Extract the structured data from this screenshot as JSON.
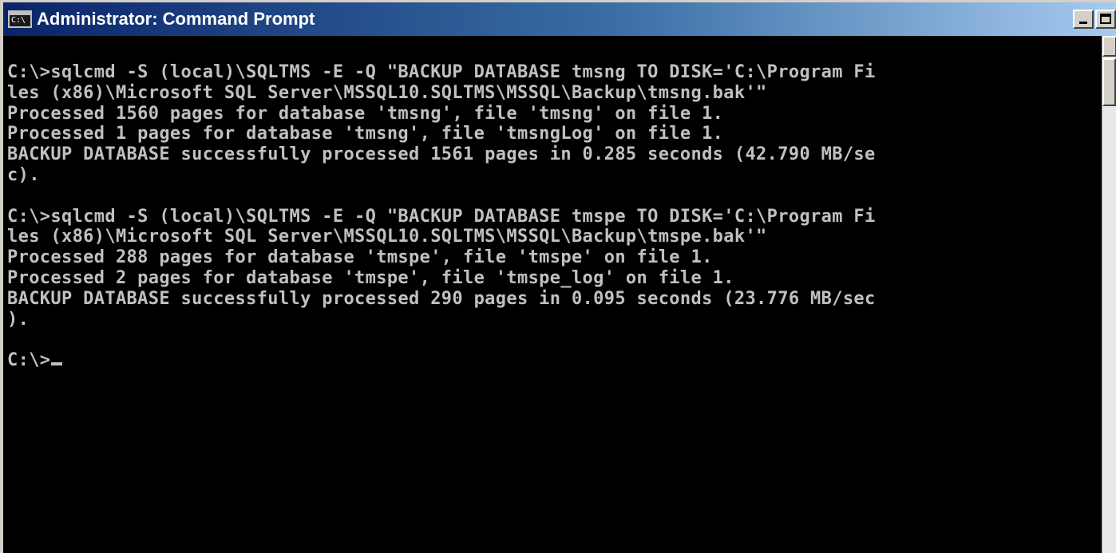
{
  "window": {
    "title": "Administrator: Command Prompt",
    "icon": "cmd-icon",
    "icon_glyph": "C:\\"
  },
  "colors": {
    "title_bar": "#0a246a",
    "console_background": "#000000",
    "console_text": "#c0c0c0"
  },
  "console": {
    "lines": [
      "C:\\>sqlcmd -S (local)\\SQLTMS -E -Q \"BACKUP DATABASE tmsng TO DISK='C:\\Program Fi",
      "les (x86)\\Microsoft SQL Server\\MSSQL10.SQLTMS\\MSSQL\\Backup\\tmsng.bak'\"",
      "Processed 1560 pages for database 'tmsng', file 'tmsng' on file 1.",
      "Processed 1 pages for database 'tmsng', file 'tmsngLog' on file 1.",
      "BACKUP DATABASE successfully processed 1561 pages in 0.285 seconds (42.790 MB/se",
      "c).",
      "",
      "C:\\>sqlcmd -S (local)\\SQLTMS -E -Q \"BACKUP DATABASE tmspe TO DISK='C:\\Program Fi",
      "les (x86)\\Microsoft SQL Server\\MSSQL10.SQLTMS\\MSSQL\\Backup\\tmspe.bak'\"",
      "Processed 288 pages for database 'tmspe', file 'tmspe' on file 1.",
      "Processed 2 pages for database 'tmspe', file 'tmspe_log' on file 1.",
      "BACKUP DATABASE successfully processed 290 pages in 0.095 seconds (23.776 MB/sec",
      ").",
      ""
    ],
    "prompt": "C:\\>"
  }
}
